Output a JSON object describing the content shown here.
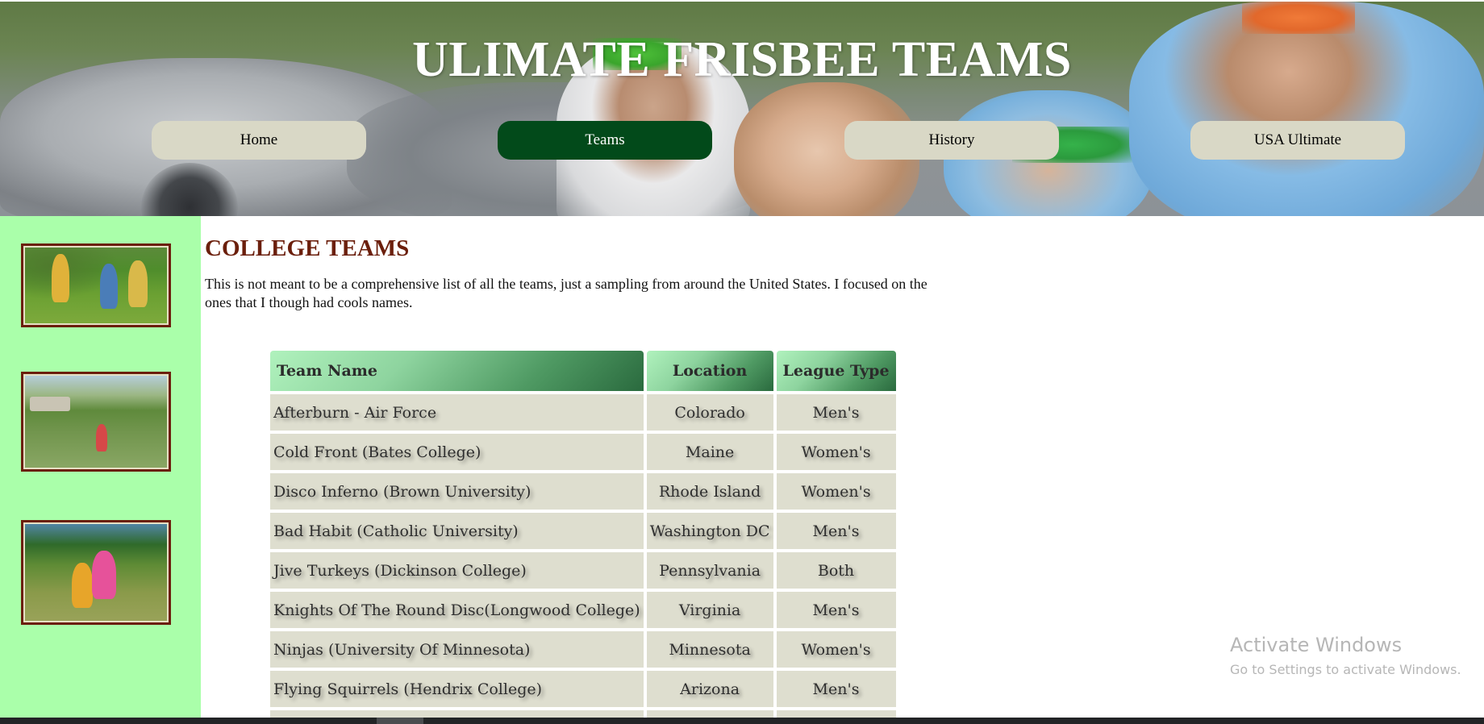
{
  "header": {
    "title": "ULIMATE FRISBEE TEAMS"
  },
  "nav": {
    "items": [
      {
        "label": "Home",
        "active": false
      },
      {
        "label": "Teams",
        "active": true
      },
      {
        "label": "History",
        "active": false
      },
      {
        "label": "USA Ultimate",
        "active": false
      }
    ]
  },
  "colors": {
    "nav_active": "#024a1a",
    "nav_inactive": "#d9d8c6",
    "sidebar_bg": "#aaffaa",
    "heading": "#6b1f0c",
    "table_cell_bg": "#dedecf"
  },
  "main": {
    "heading": "COLLEGE TEAMS",
    "intro": "This is not meant to be a comprehensive list of all the teams, just a sampling from around the United States. I focused on the ones that I though had cools names."
  },
  "table": {
    "headers": [
      "Team Name",
      "Location",
      "League Type"
    ],
    "rows": [
      [
        "Afterburn - Air Force",
        "Colorado",
        "Men's"
      ],
      [
        "Cold Front (Bates College)",
        "Maine",
        "Women's"
      ],
      [
        "Disco Inferno (Brown University)",
        "Rhode Island",
        "Women's"
      ],
      [
        "Bad Habit (Catholic University)",
        "Washington DC",
        "Men's"
      ],
      [
        "Jive Turkeys (Dickinson College)",
        "Pennsylvania",
        "Both"
      ],
      [
        "Knights Of The Round Disc(Longwood College)",
        "Virginia",
        "Men's"
      ],
      [
        "Ninjas (University Of Minnesota)",
        "Minnesota",
        "Women's"
      ],
      [
        "Flying Squirrels (Hendrix College)",
        "Arizona",
        "Men's"
      ],
      [
        "",
        "",
        ""
      ]
    ]
  },
  "watermark": {
    "title": "Activate Windows",
    "subtitle": "Go to Settings to activate Windows."
  }
}
